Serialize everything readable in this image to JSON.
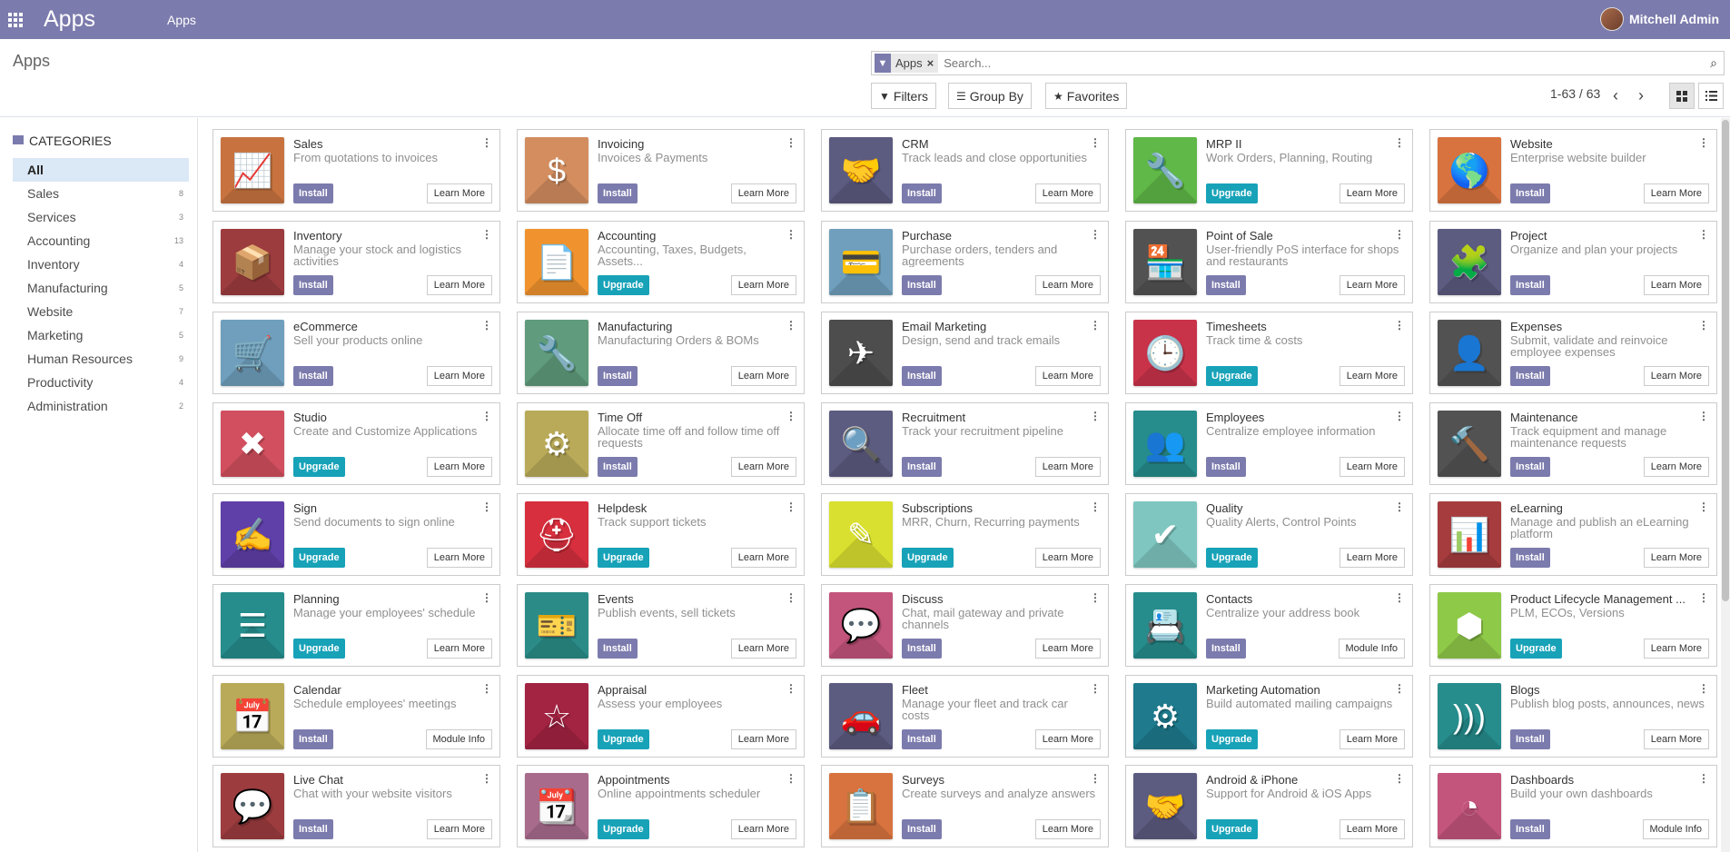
{
  "topbar": {
    "brand": "Apps",
    "nav_item": "Apps",
    "user": "Mitchell Admin",
    "accent": "#7c7bad"
  },
  "control": {
    "breadcrumb": "Apps",
    "facet_value": "Apps",
    "search_placeholder": "Search...",
    "filters": "Filters",
    "group_by": "Group By",
    "favorites": "Favorites",
    "pager": "1-63 / 63"
  },
  "sidebar": {
    "title": "CATEGORIES",
    "items": [
      {
        "label": "All",
        "count": ""
      },
      {
        "label": "Sales",
        "count": "8"
      },
      {
        "label": "Services",
        "count": "3"
      },
      {
        "label": "Accounting",
        "count": "13"
      },
      {
        "label": "Inventory",
        "count": "4"
      },
      {
        "label": "Manufacturing",
        "count": "5"
      },
      {
        "label": "Website",
        "count": "7"
      },
      {
        "label": "Marketing",
        "count": "5"
      },
      {
        "label": "Human Resources",
        "count": "9"
      },
      {
        "label": "Productivity",
        "count": "4"
      },
      {
        "label": "Administration",
        "count": "2"
      }
    ]
  },
  "apps": [
    {
      "name": "Sales",
      "desc": "From quotations to invoices",
      "action": "Install",
      "more": "Learn More",
      "color": "#c8733f",
      "icon": "chart-up-icon",
      "glyph": "📈"
    },
    {
      "name": "Invoicing",
      "desc": "Invoices & Payments",
      "action": "Install",
      "more": "Learn More",
      "color": "#d38d5f",
      "icon": "invoice-icon",
      "glyph": "$"
    },
    {
      "name": "CRM",
      "desc": "Track leads and close opportunities",
      "action": "Install",
      "more": "Learn More",
      "color": "#5c5b80",
      "icon": "handshake-icon",
      "glyph": "🤝"
    },
    {
      "name": "MRP II",
      "desc": "Work Orders, Planning, Routing",
      "action": "Upgrade",
      "more": "Learn More",
      "color": "#5fb847",
      "icon": "wrench-icon",
      "glyph": "🔧"
    },
    {
      "name": "Website",
      "desc": "Enterprise website builder",
      "action": "Install",
      "more": "Learn More",
      "color": "#d8733f",
      "icon": "globe-icon",
      "glyph": "🌎"
    },
    {
      "name": "Inventory",
      "desc": "Manage your stock and logistics activities",
      "action": "Install",
      "more": "Learn More",
      "color": "#9c3c3e",
      "icon": "box-icon",
      "glyph": "📦"
    },
    {
      "name": "Accounting",
      "desc": "Accounting, Taxes, Budgets, Assets...",
      "action": "Upgrade",
      "more": "Learn More",
      "color": "#f0932e",
      "icon": "document-icon",
      "glyph": "📄"
    },
    {
      "name": "Purchase",
      "desc": "Purchase orders, tenders and agreements",
      "action": "Install",
      "more": "Learn More",
      "color": "#6f9fbc",
      "icon": "credit-card-icon",
      "glyph": "💳"
    },
    {
      "name": "Point of Sale",
      "desc": "User-friendly PoS interface for shops and restaurants",
      "action": "Install",
      "more": "Learn More",
      "color": "#525252",
      "icon": "shop-icon",
      "glyph": "🏪"
    },
    {
      "name": "Project",
      "desc": "Organize and plan your projects",
      "action": "Install",
      "more": "Learn More",
      "color": "#5c5b80",
      "icon": "puzzle-icon",
      "glyph": "🧩"
    },
    {
      "name": "eCommerce",
      "desc": "Sell your products online",
      "action": "Install",
      "more": "Learn More",
      "color": "#6f9fbc",
      "icon": "cart-icon",
      "glyph": "🛒"
    },
    {
      "name": "Manufacturing",
      "desc": "Manufacturing Orders & BOMs",
      "action": "Install",
      "more": "Learn More",
      "color": "#5f9b7c",
      "icon": "wrench-icon",
      "glyph": "🔧"
    },
    {
      "name": "Email Marketing",
      "desc": "Design, send and track emails",
      "action": "Install",
      "more": "Learn More",
      "color": "#4d4d4d",
      "icon": "paper-plane-icon",
      "glyph": "✈"
    },
    {
      "name": "Timesheets",
      "desc": "Track time & costs",
      "action": "Upgrade",
      "more": "Learn More",
      "color": "#c8334a",
      "icon": "clock-icon",
      "glyph": "🕒"
    },
    {
      "name": "Expenses",
      "desc": "Submit, validate and reinvoice employee expenses",
      "action": "Install",
      "more": "Learn More",
      "color": "#525252",
      "icon": "user-dollar-icon",
      "glyph": "👤"
    },
    {
      "name": "Studio",
      "desc": "Create and Customize Applications",
      "action": "Upgrade",
      "more": "Learn More",
      "color": "#d14f5e",
      "icon": "tools-icon",
      "glyph": "✖"
    },
    {
      "name": "Time Off",
      "desc": "Allocate time off and follow time off requests",
      "action": "Install",
      "more": "Learn More",
      "color": "#b9aa59",
      "icon": "user-gear-icon",
      "glyph": "⚙"
    },
    {
      "name": "Recruitment",
      "desc": "Track your recruitment pipeline",
      "action": "Install",
      "more": "Learn More",
      "color": "#5c5b80",
      "icon": "magnifier-icon",
      "glyph": "🔍"
    },
    {
      "name": "Employees",
      "desc": "Centralize employee information",
      "action": "Install",
      "more": "Learn More",
      "color": "#268c8c",
      "icon": "users-icon",
      "glyph": "👥"
    },
    {
      "name": "Maintenance",
      "desc": "Track equipment and manage maintenance requests",
      "action": "Install",
      "more": "Learn More",
      "color": "#525252",
      "icon": "hammer-icon",
      "glyph": "🔨"
    },
    {
      "name": "Sign",
      "desc": "Send documents to sign online",
      "action": "Upgrade",
      "more": "Learn More",
      "color": "#5f3fa8",
      "icon": "signature-icon",
      "glyph": "✍"
    },
    {
      "name": "Helpdesk",
      "desc": "Track support tickets",
      "action": "Upgrade",
      "more": "Learn More",
      "color": "#d72f3e",
      "icon": "lifebuoy-icon",
      "glyph": "⛑"
    },
    {
      "name": "Subscriptions",
      "desc": "MRR, Churn, Recurring payments",
      "action": "Upgrade",
      "more": "Learn More",
      "color": "#d9e02f",
      "icon": "rss-pen-icon",
      "glyph": "✎"
    },
    {
      "name": "Quality",
      "desc": "Quality Alerts, Control Points",
      "action": "Upgrade",
      "more": "Learn More",
      "color": "#7fc6c0",
      "icon": "quality-check-icon",
      "glyph": "✔"
    },
    {
      "name": "eLearning",
      "desc": "Manage and publish an eLearning platform",
      "action": "Install",
      "more": "Learn More",
      "color": "#a63c3e",
      "icon": "presentation-icon",
      "glyph": "📊"
    },
    {
      "name": "Planning",
      "desc": "Manage your employees' schedule",
      "action": "Upgrade",
      "more": "Learn More",
      "color": "#268c8c",
      "icon": "planning-icon",
      "glyph": "☰"
    },
    {
      "name": "Events",
      "desc": "Publish events, sell tickets",
      "action": "Install",
      "more": "Learn More",
      "color": "#2b8c87",
      "icon": "ticket-icon",
      "glyph": "🎫"
    },
    {
      "name": "Discuss",
      "desc": "Chat, mail gateway and private channels",
      "action": "Install",
      "more": "Learn More",
      "color": "#c3547b",
      "icon": "chat-icon",
      "glyph": "💬"
    },
    {
      "name": "Contacts",
      "desc": "Centralize your address book",
      "action": "Install",
      "more": "Module Info",
      "color": "#268c8c",
      "icon": "address-book-icon",
      "glyph": "📇"
    },
    {
      "name": "Product Lifecycle Management ...",
      "desc": "PLM, ECOs, Versions",
      "action": "Upgrade",
      "more": "Learn More",
      "color": "#8fc948",
      "icon": "cube-icon",
      "glyph": "⬢"
    },
    {
      "name": "Calendar",
      "desc": "Schedule employees' meetings",
      "action": "Install",
      "more": "Module Info",
      "color": "#b9aa59",
      "icon": "calendar-icon",
      "glyph": "📅"
    },
    {
      "name": "Appraisal",
      "desc": "Assess your employees",
      "action": "Upgrade",
      "more": "Learn More",
      "color": "#a32343",
      "icon": "star-icon",
      "glyph": "☆"
    },
    {
      "name": "Fleet",
      "desc": "Manage your fleet and track car costs",
      "action": "Install",
      "more": "Learn More",
      "color": "#5c5b80",
      "icon": "car-icon",
      "glyph": "🚗"
    },
    {
      "name": "Marketing Automation",
      "desc": "Build automated mailing campaigns",
      "action": "Upgrade",
      "more": "Learn More",
      "color": "#1e7a8c",
      "icon": "gear-mail-icon",
      "glyph": "⚙"
    },
    {
      "name": "Blogs",
      "desc": "Publish blog posts, announces, news",
      "action": "Install",
      "more": "Learn More",
      "color": "#268c8c",
      "icon": "rss-icon",
      "glyph": ")))"
    },
    {
      "name": "Live Chat",
      "desc": "Chat with your website visitors",
      "action": "Install",
      "more": "Learn More",
      "color": "#9c3c3e",
      "icon": "chat-bubbles-icon",
      "glyph": "💬"
    },
    {
      "name": "Appointments",
      "desc": "Online appointments scheduler",
      "action": "Upgrade",
      "more": "Learn More",
      "color": "#a86b8c",
      "icon": "calendar-clock-icon",
      "glyph": "📆"
    },
    {
      "name": "Surveys",
      "desc": "Create surveys and analyze answers",
      "action": "Install",
      "more": "Learn More",
      "color": "#d8733f",
      "icon": "clipboard-icon",
      "glyph": "📋"
    },
    {
      "name": "Android & iPhone",
      "desc": "Support for Android & iOS Apps",
      "action": "Upgrade",
      "more": "Learn More",
      "color": "#5c5b80",
      "icon": "handshake-icon",
      "glyph": "🤝"
    },
    {
      "name": "Dashboards",
      "desc": "Build your own dashboards",
      "action": "Install",
      "more": "Module Info",
      "color": "#c3547b",
      "icon": "gauge-icon",
      "glyph": "◔"
    }
  ]
}
